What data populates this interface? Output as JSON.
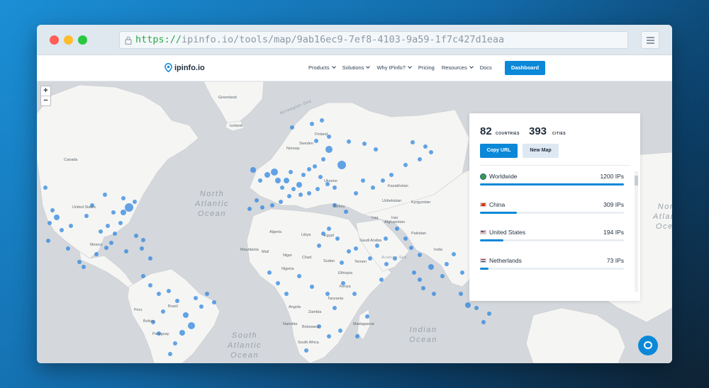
{
  "browser": {
    "url_protocol": "https://",
    "url_rest": "ipinfo.io/tools/map/9ab16ec9-7ef8-4103-9a59-1f7c427d1eaa"
  },
  "nav": {
    "logo_text": "ipinfo.io",
    "items": [
      {
        "label": "Products",
        "dropdown": true
      },
      {
        "label": "Solutions",
        "dropdown": true
      },
      {
        "label": "Why IPinfo?",
        "dropdown": true
      },
      {
        "label": "Pricing",
        "dropdown": false
      },
      {
        "label": "Resources",
        "dropdown": true
      },
      {
        "label": "Docs",
        "dropdown": false
      }
    ],
    "dashboard_label": "Dashboard"
  },
  "map": {
    "zoom_in": "+",
    "zoom_out": "−",
    "oceans": {
      "north_atlantic": "North Atlantic Ocean",
      "south_atlantic": "South Atlantic Ocean",
      "indian": "Indian Ocean",
      "north_atlantic_right": "North Atlantic Ocean",
      "arabian_sea": "Arabian Sea",
      "norwegian_sea": "Norwegian Sea"
    },
    "labels": {
      "canada": "Canada",
      "united_states": "United States",
      "mexico": "Mexico",
      "brazil": "Brazil",
      "peru": "Peru",
      "bolivia": "Bolivia",
      "paraguay": "Paraguay",
      "algeria": "Algeria",
      "libya": "Libya",
      "egypt": "Egypt",
      "mali": "Mali",
      "niger": "Niger",
      "chad": "Chad",
      "sudan": "Sudan",
      "mauritania": "Mauritania",
      "nigeria": "Nigeria",
      "ethiopia": "Ethiopia",
      "kenya": "Kenya",
      "tanzania": "Tanzania",
      "angola": "Angola",
      "zambia": "Zambia",
      "namibia": "Namibia",
      "botswana": "Botswana",
      "south_africa": "South Africa",
      "madagascar": "Madagascar",
      "saudi_arabia": "Saudi Arabia",
      "iran": "Iran",
      "iraq": "Iraq",
      "turkey": "Turkey",
      "pakistan": "Pakistan",
      "afghanistan": "Afghanistan",
      "india": "India",
      "yemen": "Yemen",
      "kazakhstan": "Kazakhstan",
      "uzbekistan": "Uzbekistan",
      "ukraine": "Ukraine",
      "finland": "Finland",
      "sweden": "Sweden",
      "norway": "Norway",
      "iceland": "Iceland",
      "greenland": "Greenland",
      "kyrgyzstan": "Kyrgyzstan"
    }
  },
  "panel": {
    "countries_count": "82",
    "countries_label": "COUNTRIES",
    "cities_count": "393",
    "cities_label": "CITIES",
    "copy_url_label": "Copy URL",
    "new_map_label": "New Map",
    "rows": [
      {
        "name": "Worldwide",
        "count": "1200 IPs",
        "fraction": 1.0,
        "icon": "globe-icon"
      },
      {
        "name": "China",
        "count": "309 IPs",
        "fraction": 0.2575,
        "icon": "china-flag-icon"
      },
      {
        "name": "United States",
        "count": "194 IPs",
        "fraction": 0.1617,
        "icon": "us-flag-icon"
      },
      {
        "name": "Netherlands",
        "count": "73 IPs",
        "fraction": 0.0608,
        "icon": "netherlands-flag-icon"
      }
    ]
  },
  "colors": {
    "accent": "#0b88d8",
    "map_land": "#f5f5f3",
    "map_water": "#d4d7db",
    "ip_dot": "#2f86e0"
  }
}
